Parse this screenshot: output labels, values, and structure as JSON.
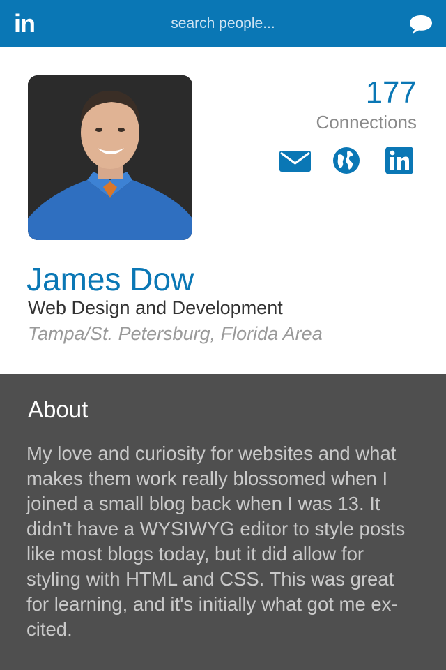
{
  "header": {
    "logo_text": "in",
    "search_placeholder": "search people...",
    "messages_icon": "chat-bubble-icon",
    "brand_color": "#0a77b5"
  },
  "profile": {
    "connections_count": "177",
    "connections_label": "Connections",
    "contact_icons": [
      "envelope-icon",
      "globe-icon",
      "linkedin-icon"
    ],
    "name": "James Dow",
    "headline": "Web Design and Development",
    "location": "Tampa/St. Petersburg, Florida Area"
  },
  "about": {
    "title": "About",
    "text": "My love and curiosity for websites and what makes them work really blossomed when I joined a small blog back when I was 13. It didn't have a WYSIWYG editor to style posts like most blogs today, but it did allow for styling with HTML and CSS. This was great for learning, and it's initially what got me ex-cited."
  },
  "colors": {
    "accent": "#0a77b5",
    "about_background": "#4f4f4f",
    "muted_text": "#8a8a8a"
  }
}
